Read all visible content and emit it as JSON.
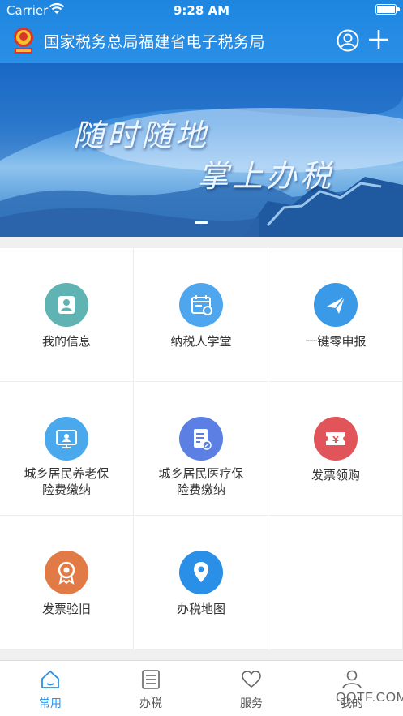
{
  "status_bar": {
    "carrier": "Carrier",
    "time": "9:28 AM"
  },
  "header": {
    "title": "国家税务总局福建省电子税务局"
  },
  "banner": {
    "slogan_line1": "随时随地",
    "slogan_line2": "掌上办税"
  },
  "grid": {
    "items": [
      {
        "label": "我的信息",
        "icon": "person-icon",
        "color": "#5fb3b3"
      },
      {
        "label": "纳税人学堂",
        "icon": "calendar-icon",
        "color": "#4ea7ee"
      },
      {
        "label": "一键零申报",
        "icon": "paper-plane-icon",
        "color": "#3a9ae8"
      },
      {
        "label_line1": "城乡居民养老保",
        "label_line2": "险费缴纳",
        "icon": "monitor-icon",
        "color": "#4aa9ec"
      },
      {
        "label_line1": "城乡居民医疗保",
        "label_line2": "险费缴纳",
        "icon": "document-edit-icon",
        "color": "#5b7fe2"
      },
      {
        "label": "发票领购",
        "icon": "yen-ticket-icon",
        "color": "#e1545a"
      },
      {
        "label": "发票验旧",
        "icon": "award-icon",
        "color": "#e27a45"
      },
      {
        "label": "办税地图",
        "icon": "map-pin-icon",
        "color": "#2a8fe6"
      }
    ]
  },
  "tabbar": {
    "tabs": [
      {
        "label": "常用",
        "icon": "home-icon",
        "active": true
      },
      {
        "label": "办税",
        "icon": "list-icon",
        "active": false
      },
      {
        "label": "服务",
        "icon": "heart-icon",
        "active": false
      },
      {
        "label": "我的",
        "icon": "user-icon",
        "active": false
      }
    ]
  },
  "watermark": "QQTF.COM",
  "colors": {
    "primary": "#2a8fe6",
    "text": "#333333"
  }
}
